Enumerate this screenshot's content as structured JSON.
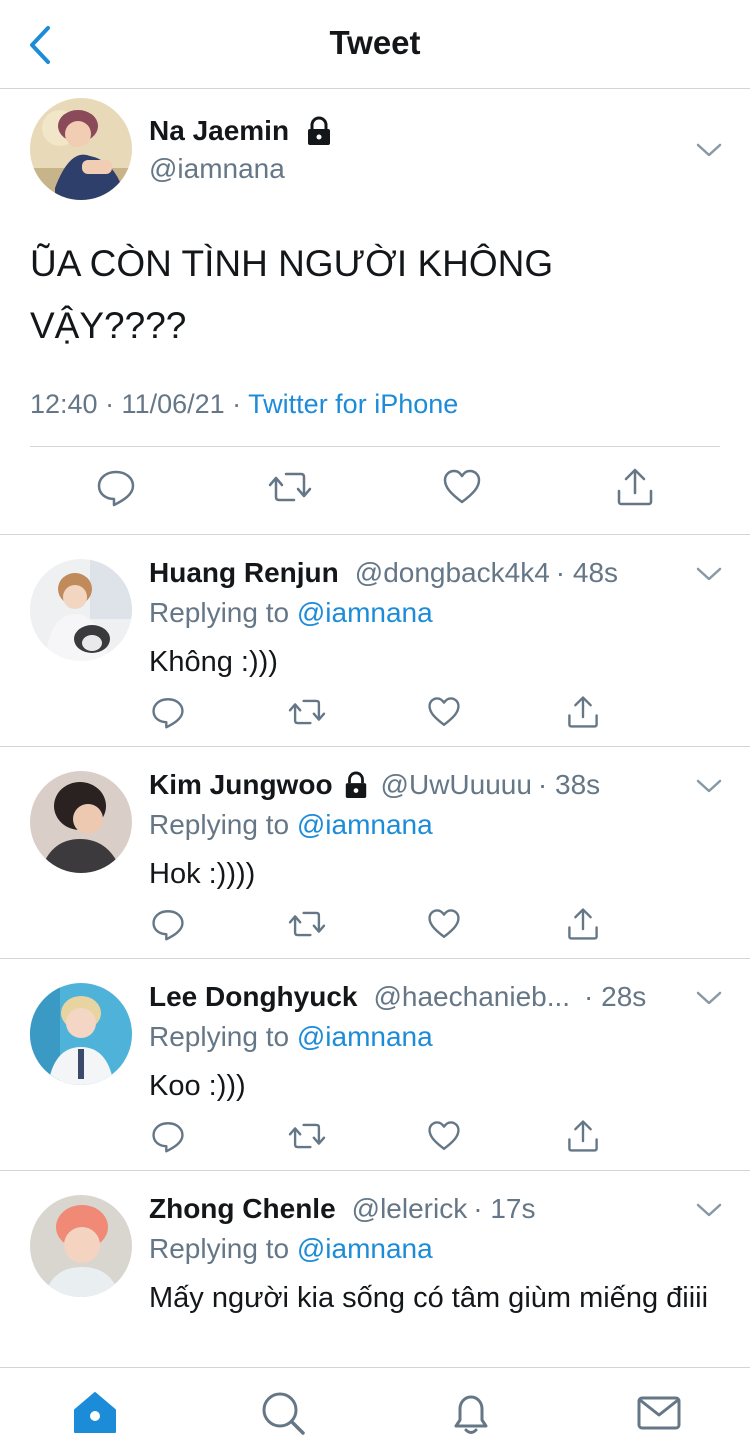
{
  "header": {
    "title": "Tweet",
    "back_icon": "chevron-left-icon"
  },
  "colors": {
    "accent": "#1d8cd8",
    "text": "#14171a",
    "secondary": "#657786",
    "divider": "#d0d5d9"
  },
  "main_tweet": {
    "name": "Na Jaemin",
    "handle": "@iamnana",
    "locked": true,
    "text": "ŨA CÒN TÌNH NGƯỜI KHÔNG VẬY????",
    "time": "12:40 · 11/06/21 · ",
    "source": "Twitter for iPhone"
  },
  "replies": [
    {
      "name": "Huang Renjun",
      "handle": "@dongback4k4",
      "time": "· 48s",
      "locked": false,
      "replying_label": "Replying to ",
      "replying_to": "@iamnana",
      "text": "Không :)))"
    },
    {
      "name": "Kim Jungwoo",
      "handle": "@UwUuuuu",
      "time": "· 38s",
      "locked": true,
      "replying_label": "Replying to ",
      "replying_to": "@iamnana",
      "text": "Hok :))))"
    },
    {
      "name": "Lee Donghyuck",
      "handle": "@haechanieb...",
      "time": "· 28s",
      "locked": false,
      "replying_label": "Replying to ",
      "replying_to": "@iamnana",
      "text": "Koo :)))"
    },
    {
      "name": "Zhong Chenle",
      "handle": "@lelerick",
      "time": "· 17s",
      "locked": false,
      "replying_label": "Replying to ",
      "replying_to": "@iamnana",
      "text": "Mấy người kia sống có tâm giùm miếng điiii"
    }
  ],
  "actions": [
    "reply-icon",
    "retweet-icon",
    "like-icon",
    "share-icon"
  ],
  "tabbar": [
    "home-icon",
    "search-icon",
    "notifications-icon",
    "messages-icon"
  ]
}
